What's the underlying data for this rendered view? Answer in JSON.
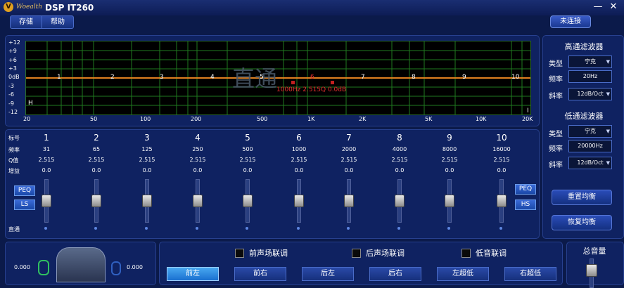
{
  "window": {
    "brand": "Woealth",
    "title": "DSP IT260",
    "minimize_glyph": "—",
    "close_glyph": "✕"
  },
  "menu": {
    "items": [
      "存储",
      "帮助"
    ],
    "connect_label": "未连接"
  },
  "graph": {
    "y_ticks": [
      "+12",
      "+9",
      "+6",
      "+3",
      "0dB",
      "-3",
      "-6",
      "-9",
      "-12"
    ],
    "x_ticks": [
      "20",
      "50",
      "100",
      "200",
      "500",
      "1K",
      "2K",
      "5K",
      "10K",
      "20K"
    ],
    "band_markers": [
      "1",
      "2",
      "3",
      "4",
      "5",
      "6",
      "7",
      "8",
      "9",
      "10"
    ],
    "overlay_text": "直通",
    "point_info": "1000Hz 2.515Q 0.0dB",
    "low_marker": "H",
    "high_marker": "I"
  },
  "eq": {
    "row_labels": {
      "band": "标号",
      "freq": "频率",
      "q": "Q值",
      "gain": "增益",
      "bypass": "直通"
    },
    "bands": [
      {
        "num": "1",
        "freq": "31",
        "q": "2.515",
        "gain": "0.0"
      },
      {
        "num": "2",
        "freq": "65",
        "q": "2.515",
        "gain": "0.0"
      },
      {
        "num": "3",
        "freq": "125",
        "q": "2.515",
        "gain": "0.0"
      },
      {
        "num": "4",
        "freq": "250",
        "q": "2.515",
        "gain": "0.0"
      },
      {
        "num": "5",
        "freq": "500",
        "q": "2.515",
        "gain": "0.0"
      },
      {
        "num": "6",
        "freq": "1000",
        "q": "2.515",
        "gain": "0.0"
      },
      {
        "num": "7",
        "freq": "2000",
        "q": "2.515",
        "gain": "0.0"
      },
      {
        "num": "8",
        "freq": "4000",
        "q": "2.515",
        "gain": "0.0"
      },
      {
        "num": "9",
        "freq": "8000",
        "q": "2.515",
        "gain": "0.0"
      },
      {
        "num": "10",
        "freq": "16000",
        "q": "2.515",
        "gain": "0.0"
      }
    ],
    "left_buttons": [
      "PEQ",
      "LS"
    ],
    "right_buttons": [
      "PEQ",
      "HS"
    ]
  },
  "highpass": {
    "title": "高通滤波器",
    "type_label": "类型",
    "type_value": "宁克",
    "freq_label": "频率",
    "freq_value": "20Hz",
    "slope_label": "斜率",
    "slope_value": "12dB/Oct"
  },
  "lowpass": {
    "title": "低通滤波器",
    "type_label": "类型",
    "type_value": "宁克",
    "freq_label": "频率",
    "freq_value": "20000Hz",
    "slope_label": "斜率",
    "slope_value": "12dB/Oct"
  },
  "side_buttons": {
    "reset": "重置均衡",
    "restore": "恢复均衡"
  },
  "speaker": {
    "left_value": "0.000",
    "right_value": "0.000"
  },
  "linking": {
    "front": "前声场联调",
    "rear": "后声场联调",
    "sub": "低音联调"
  },
  "channels": [
    "前左",
    "前右",
    "后左",
    "后右",
    "左超低",
    "右超低"
  ],
  "volume": {
    "title": "总音量"
  }
}
